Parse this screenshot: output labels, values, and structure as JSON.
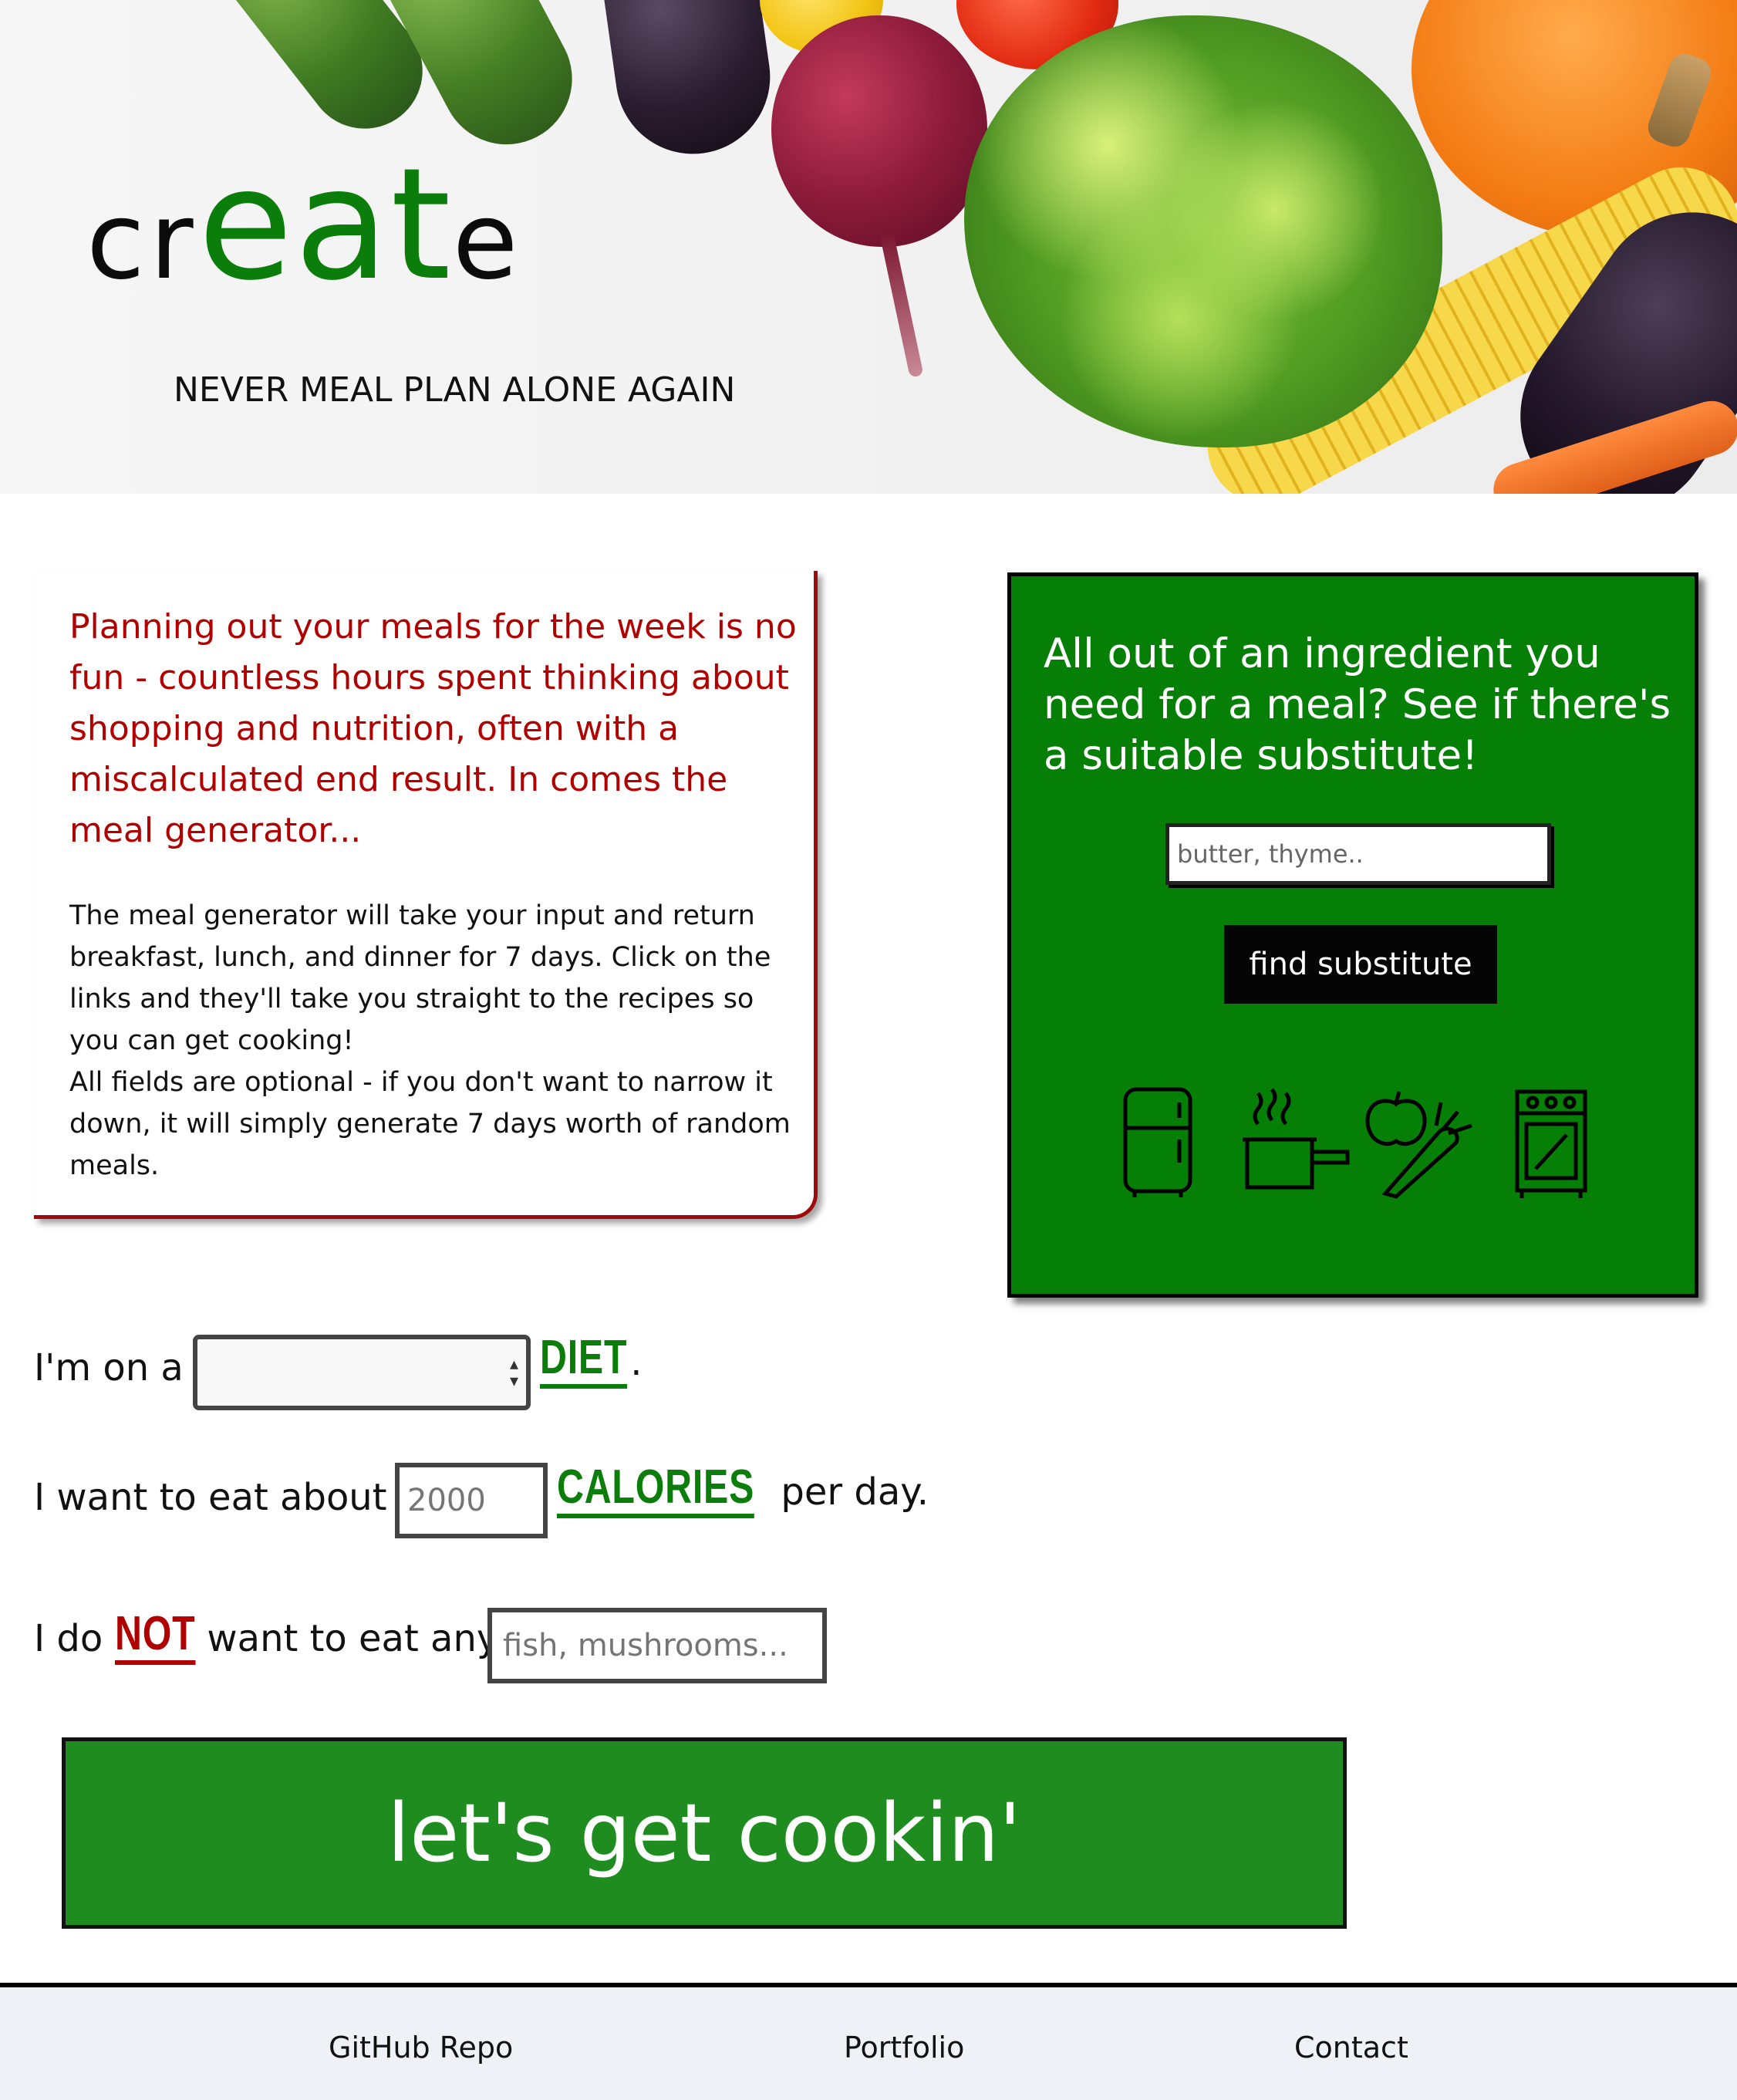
{
  "hero": {
    "logo": {
      "parts": [
        "cr",
        "eat",
        "e"
      ]
    },
    "tagline": "NEVER MEAL PLAN ALONE AGAIN"
  },
  "intro": {
    "lead": "Planning out your meals for the week is no fun - countless hours spent thinking about shopping and nutrition, often with a miscalculated end result. In comes the meal generator...",
    "body_p1": "The meal generator will take your input and return breakfast, lunch, and dinner for 7 days. Click on the links and they'll take you straight to the recipes so you can get cooking!",
    "body_p2": "All fields are optional - if you don't want to narrow it down, it will simply generate 7 days worth of random meals."
  },
  "substitute": {
    "title": "All out of an ingredient you need for a meal? See if there's a suitable substitute!",
    "input_placeholder": "butter, thyme..",
    "button_label": "find substitute",
    "icons": [
      "fridge-icon",
      "pot-icon",
      "vegetables-icon",
      "oven-icon"
    ]
  },
  "form": {
    "diet": {
      "prefix": "I'm on a",
      "selected": "",
      "accent": "DIET",
      "suffix": "."
    },
    "calories": {
      "prefix": "I want to eat about",
      "placeholder": "2000",
      "accent": "CALORIES",
      "suffix": "per day."
    },
    "exclude": {
      "prefix": "I do",
      "accent": "NOT",
      "middle": "want to eat any",
      "placeholder": "fish, mushrooms..."
    },
    "submit_label": "let's get cookin'"
  },
  "footer": {
    "links": [
      "GitHub Repo",
      "Portfolio",
      "Contact"
    ]
  },
  "colors": {
    "brand_green": "#0a7d0a",
    "accent_red": "#b00000",
    "panel_green": "#067f06",
    "button_green": "#1e8c1e"
  }
}
